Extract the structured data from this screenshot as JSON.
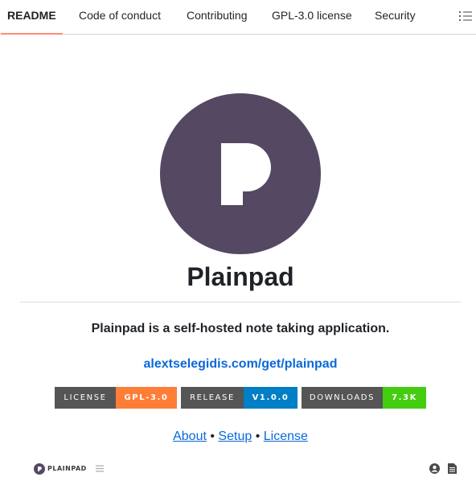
{
  "tabs": [
    {
      "label": "README",
      "active": true
    },
    {
      "label": "Code of conduct",
      "active": false
    },
    {
      "label": "Contributing",
      "active": false
    },
    {
      "label": "GPL-3.0 license",
      "active": false
    },
    {
      "label": "Security",
      "active": false
    }
  ],
  "toolbar": {
    "outline_icon": "list-unordered-icon"
  },
  "readme": {
    "logo_icon": "plainpad-logo",
    "title": "Plainpad",
    "tagline": "Plainpad is a self-hosted note taking application.",
    "site_link": "alextselegidis.com/get/plainpad",
    "badges": [
      {
        "label": "LICENSE",
        "value": "GPL-3.0",
        "color": "#fe7d37"
      },
      {
        "label": "RELEASE",
        "value": "V1.0.0",
        "color": "#007ec6"
      },
      {
        "label": "DOWNLOADS",
        "value": "7.3K",
        "color": "#4c1"
      }
    ],
    "links": [
      "About",
      "Setup",
      "License"
    ],
    "separator": "•"
  },
  "preview": {
    "brand": "PLAINPAD",
    "icons": [
      "plainpad-logo-icon",
      "menu-icon",
      "user-icon",
      "document-icon"
    ]
  },
  "colors": {
    "accent": "#fd8c73",
    "link": "#0969da",
    "logo_bg": "#554863"
  }
}
